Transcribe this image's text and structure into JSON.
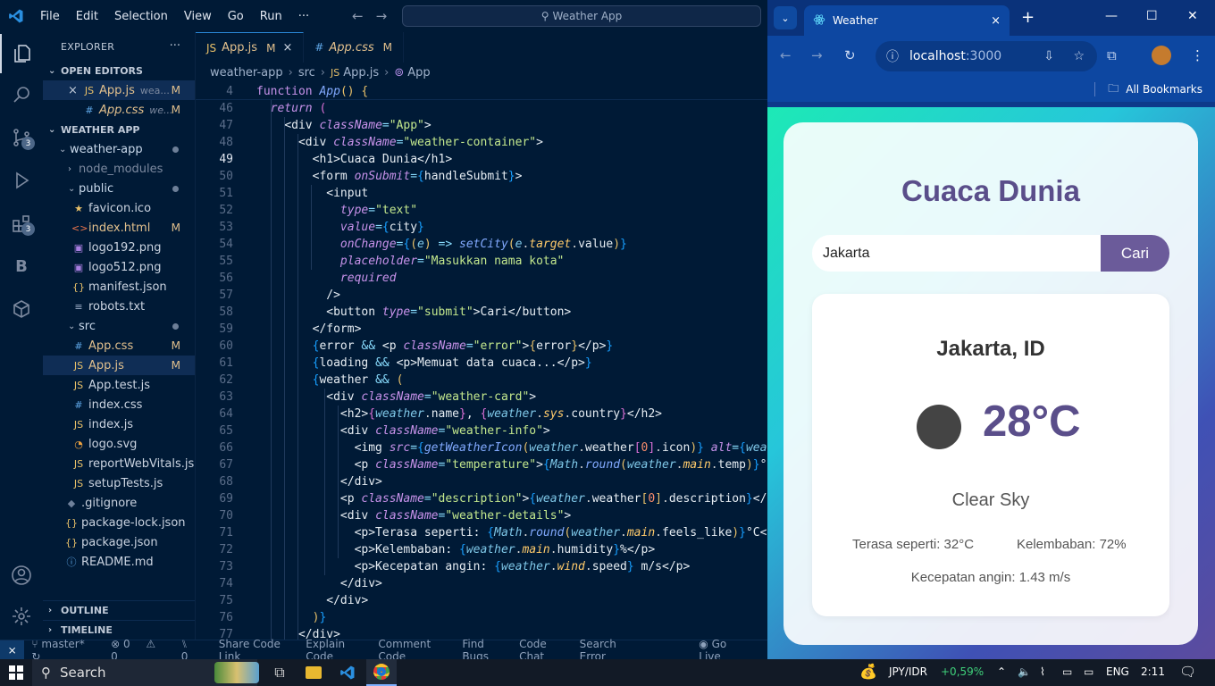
{
  "vscode": {
    "menu": [
      "File",
      "Edit",
      "Selection",
      "View",
      "Go",
      "Run",
      "···"
    ],
    "command_center": "Weather App",
    "explorer_title": "EXPLORER",
    "open_editors_label": "OPEN EDITORS",
    "open_editors": [
      {
        "name": "App.js",
        "dir": "wea...",
        "status": "M"
      },
      {
        "name": "App.css",
        "dir": "we...",
        "status": "M"
      }
    ],
    "project_label": "WEATHER APP",
    "tree": {
      "root": "weather-app",
      "node_modules": "node_modules",
      "public": "public",
      "public_files": [
        {
          "name": "favicon.ico",
          "status": ""
        },
        {
          "name": "index.html",
          "status": "M"
        },
        {
          "name": "logo192.png",
          "status": ""
        },
        {
          "name": "logo512.png",
          "status": ""
        },
        {
          "name": "manifest.json",
          "status": ""
        },
        {
          "name": "robots.txt",
          "status": ""
        }
      ],
      "src": "src",
      "src_files": [
        {
          "name": "App.css",
          "status": "M"
        },
        {
          "name": "App.js",
          "status": "M"
        },
        {
          "name": "App.test.js",
          "status": ""
        },
        {
          "name": "index.css",
          "status": ""
        },
        {
          "name": "index.js",
          "status": ""
        },
        {
          "name": "logo.svg",
          "status": ""
        },
        {
          "name": "reportWebVitals.js",
          "status": ""
        },
        {
          "name": "setupTests.js",
          "status": ""
        }
      ],
      "root_files": [
        {
          "name": ".gitignore"
        },
        {
          "name": "package-lock.json"
        },
        {
          "name": "package.json"
        },
        {
          "name": "README.md"
        }
      ]
    },
    "outline_label": "OUTLINE",
    "timeline_label": "TIMELINE",
    "activity_badges": {
      "scm": "3",
      "extensions": "3"
    },
    "tabs": [
      {
        "label": "App.js",
        "status": "M",
        "close": "×"
      },
      {
        "label": "App.css",
        "status": "M"
      }
    ],
    "breadcrumb": [
      "weather-app",
      "src",
      "App.js",
      "App"
    ],
    "sticky_line": {
      "num": "4",
      "text": "function App() {"
    },
    "line_numbers": [
      "46",
      "47",
      "48",
      "49",
      "50",
      "51",
      "52",
      "53",
      "54",
      "55",
      "56",
      "57",
      "58",
      "59",
      "60",
      "61",
      "62",
      "63",
      "64",
      "65",
      "66",
      "67",
      "68",
      "69",
      "70",
      "71",
      "72",
      "73",
      "74",
      "75",
      "76",
      "77"
    ],
    "status": {
      "branch": "master*",
      "errors": "0",
      "warnings": "0",
      "ports": "0",
      "items": [
        "Share Code Link",
        "Explain Code",
        "Comment Code",
        "Find Bugs",
        "Code Chat",
        "Search Error"
      ],
      "go_live": "Go Live"
    }
  },
  "browser": {
    "tab_title": "Weather",
    "tab_close": "×",
    "new_tab": "+",
    "url_host": "localhost",
    "url_port": ":3000",
    "bookmarks_label": "All Bookmarks"
  },
  "app": {
    "title": "Cuaca Dunia",
    "search_value": "Jakarta",
    "search_placeholder": "Masukkan nama kota",
    "search_button": "Cari",
    "city": "Jakarta, ID",
    "temperature": "28°C",
    "description": "Clear Sky",
    "feels_like": "Terasa seperti: 32°C",
    "humidity": "Kelembaban: 72%",
    "wind": "Kecepatan angin: 1.43 m/s"
  },
  "taskbar": {
    "search": "Search",
    "ticker": "JPY/IDR",
    "ticker_change": "+0,59%",
    "lang": "ENG",
    "time": "2:11"
  },
  "colors": {
    "accent": "#5a4e8a",
    "button": "#6b5b9a",
    "modified": "#e2c08d"
  }
}
